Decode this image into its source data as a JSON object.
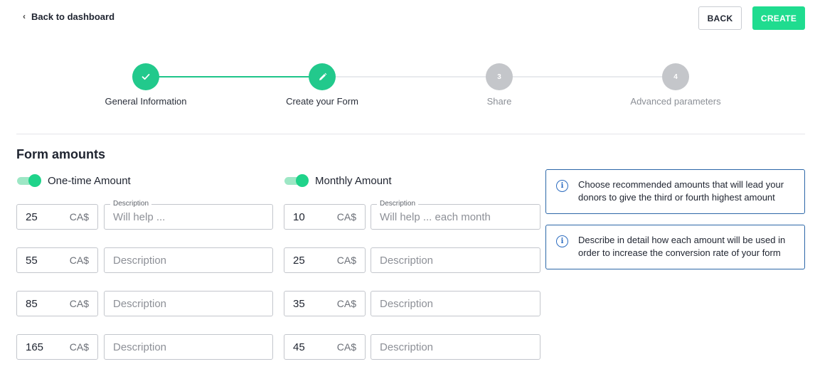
{
  "header": {
    "back_link": "Back to dashboard",
    "back_button": "BACK",
    "create_button": "CREATE"
  },
  "stepper": {
    "steps": [
      {
        "label": "General Information",
        "state": "done",
        "icon": "check-icon",
        "number": ""
      },
      {
        "label": "Create your Form",
        "state": "active",
        "icon": "pencil-icon",
        "number": ""
      },
      {
        "label": "Share",
        "state": "todo",
        "icon": "",
        "number": "3"
      },
      {
        "label": "Advanced parameters",
        "state": "todo",
        "icon": "",
        "number": "4"
      }
    ]
  },
  "form": {
    "title": "Form amounts",
    "one_time": {
      "toggle_label": "One-time Amount",
      "enabled": true,
      "rows": [
        {
          "amount": "25",
          "currency": "CA$",
          "description_label": "Description",
          "description_placeholder": "Will help ..."
        },
        {
          "amount": "55",
          "currency": "CA$",
          "description_label": "",
          "description_placeholder": "Description"
        },
        {
          "amount": "85",
          "currency": "CA$",
          "description_label": "",
          "description_placeholder": "Description"
        },
        {
          "amount": "165",
          "currency": "CA$",
          "description_label": "",
          "description_placeholder": "Description"
        }
      ]
    },
    "monthly": {
      "toggle_label": "Monthly Amount",
      "enabled": true,
      "rows": [
        {
          "amount": "10",
          "currency": "CA$",
          "description_label": "Description",
          "description_placeholder": "Will help ... each month"
        },
        {
          "amount": "25",
          "currency": "CA$",
          "description_label": "",
          "description_placeholder": "Description"
        },
        {
          "amount": "35",
          "currency": "CA$",
          "description_label": "",
          "description_placeholder": "Description"
        },
        {
          "amount": "45",
          "currency": "CA$",
          "description_label": "",
          "description_placeholder": "Description"
        }
      ]
    }
  },
  "tips": [
    {
      "text": "Choose recommended amounts that will lead your donors to give the third or fourth highest amount",
      "icon": "info-icon"
    },
    {
      "text": "Describe in detail how each amount will be used in order to increase the conversion rate of your form",
      "icon": "info-icon"
    }
  ],
  "colors": {
    "accent": "#1fdc8f",
    "info_border": "#2c67a8"
  }
}
